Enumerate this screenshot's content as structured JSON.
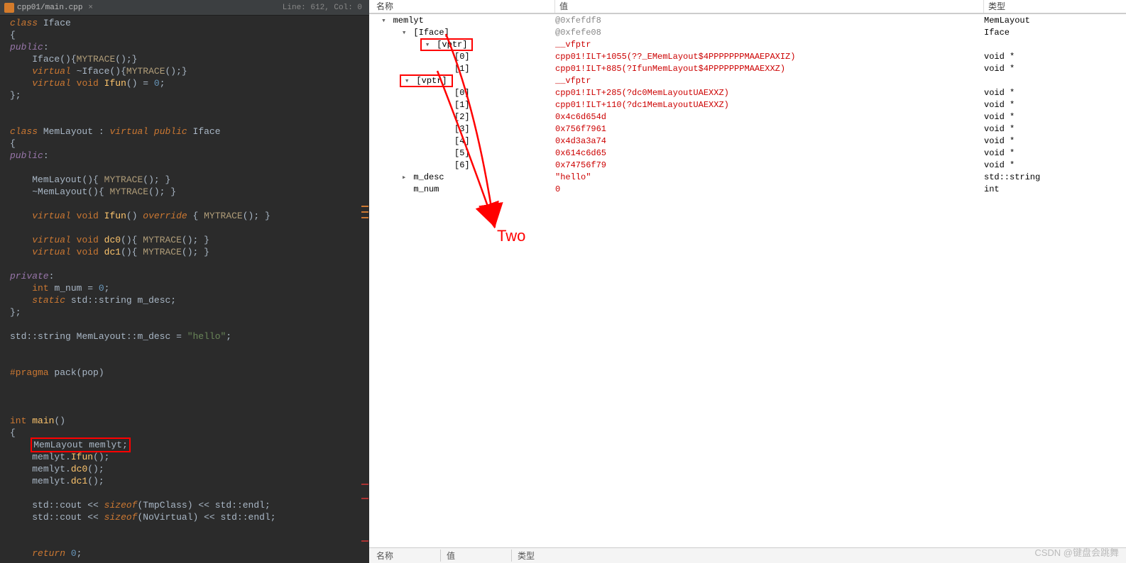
{
  "tab": {
    "filename": "cpp01/main.cpp",
    "close": "×"
  },
  "statusbar": {
    "linecol": "Line: 612, Col: 0"
  },
  "code_lines": [
    [
      [
        "key",
        "class"
      ],
      [
        "sp",
        " "
      ],
      [
        "type",
        "Iface"
      ]
    ],
    [
      [
        "op",
        "{"
      ]
    ],
    [
      [
        "pub",
        "public"
      ],
      [
        "op",
        ":"
      ]
    ],
    [
      [
        "sp",
        "    "
      ],
      [
        "type",
        "Iface"
      ],
      [
        "op",
        "()"
      ],
      [
        "op",
        "{"
      ],
      [
        "call",
        "MYTRACE"
      ],
      [
        "op",
        "();"
      ],
      [
        "op",
        "}"
      ]
    ],
    [
      [
        "sp",
        "    "
      ],
      [
        "key",
        "virtual"
      ],
      [
        "sp",
        " "
      ],
      [
        "op",
        "~"
      ],
      [
        "type",
        "Iface"
      ],
      [
        "op",
        "()"
      ],
      [
        "op",
        "{"
      ],
      [
        "call",
        "MYTRACE"
      ],
      [
        "op",
        "();"
      ],
      [
        "op",
        "}"
      ]
    ],
    [
      [
        "sp",
        "    "
      ],
      [
        "key",
        "virtual"
      ],
      [
        "sp",
        " "
      ],
      [
        "key2",
        "void"
      ],
      [
        "sp",
        " "
      ],
      [
        "fn",
        "Ifun"
      ],
      [
        "op",
        "() = "
      ],
      [
        "num",
        "0"
      ],
      [
        "op",
        ";"
      ]
    ],
    [
      [
        "op",
        "};"
      ]
    ],
    [
      [
        "sp",
        ""
      ]
    ],
    [
      [
        "sp",
        ""
      ]
    ],
    [
      [
        "key",
        "class"
      ],
      [
        "sp",
        " "
      ],
      [
        "type",
        "MemLayout"
      ],
      [
        "sp",
        " "
      ],
      [
        "op",
        ":"
      ],
      [
        "sp",
        " "
      ],
      [
        "key",
        "virtual"
      ],
      [
        "sp",
        " "
      ],
      [
        "key",
        "public"
      ],
      [
        "sp",
        " "
      ],
      [
        "type",
        "Iface"
      ]
    ],
    [
      [
        "op",
        "{"
      ]
    ],
    [
      [
        "pub",
        "public"
      ],
      [
        "op",
        ":"
      ]
    ],
    [
      [
        "sp",
        ""
      ]
    ],
    [
      [
        "sp",
        "    "
      ],
      [
        "type",
        "MemLayout"
      ],
      [
        "op",
        "(){ "
      ],
      [
        "call",
        "MYTRACE"
      ],
      [
        "op",
        "(); }"
      ]
    ],
    [
      [
        "sp",
        "    "
      ],
      [
        "op",
        "~"
      ],
      [
        "type",
        "MemLayout"
      ],
      [
        "op",
        "(){ "
      ],
      [
        "call",
        "MYTRACE"
      ],
      [
        "op",
        "(); }"
      ]
    ],
    [
      [
        "sp",
        ""
      ]
    ],
    [
      [
        "sp",
        "    "
      ],
      [
        "key",
        "virtual"
      ],
      [
        "sp",
        " "
      ],
      [
        "key2",
        "void"
      ],
      [
        "sp",
        " "
      ],
      [
        "fn",
        "Ifun"
      ],
      [
        "op",
        "() "
      ],
      [
        "key",
        "override"
      ],
      [
        "op",
        " { "
      ],
      [
        "call",
        "MYTRACE"
      ],
      [
        "op",
        "(); }"
      ]
    ],
    [
      [
        "sp",
        ""
      ]
    ],
    [
      [
        "sp",
        "    "
      ],
      [
        "key",
        "virtual"
      ],
      [
        "sp",
        " "
      ],
      [
        "key2",
        "void"
      ],
      [
        "sp",
        " "
      ],
      [
        "fn",
        "dc0"
      ],
      [
        "op",
        "(){ "
      ],
      [
        "call",
        "MYTRACE"
      ],
      [
        "op",
        "(); }"
      ]
    ],
    [
      [
        "sp",
        "    "
      ],
      [
        "key",
        "virtual"
      ],
      [
        "sp",
        " "
      ],
      [
        "key2",
        "void"
      ],
      [
        "sp",
        " "
      ],
      [
        "fn",
        "dc1"
      ],
      [
        "op",
        "(){ "
      ],
      [
        "call",
        "MYTRACE"
      ],
      [
        "op",
        "(); }"
      ]
    ],
    [
      [
        "sp",
        ""
      ]
    ],
    [
      [
        "pub",
        "private"
      ],
      [
        "op",
        ":"
      ]
    ],
    [
      [
        "sp",
        "    "
      ],
      [
        "key2",
        "int"
      ],
      [
        "sp",
        " "
      ],
      [
        "id",
        "m_num"
      ],
      [
        "op",
        " = "
      ],
      [
        "num",
        "0"
      ],
      [
        "op",
        ";"
      ]
    ],
    [
      [
        "sp",
        "    "
      ],
      [
        "key",
        "static"
      ],
      [
        "sp",
        " "
      ],
      [
        "id",
        "std"
      ],
      [
        "op",
        "::"
      ],
      [
        "id",
        "string"
      ],
      [
        "sp",
        " "
      ],
      [
        "id",
        "m_desc"
      ],
      [
        "op",
        ";"
      ]
    ],
    [
      [
        "op",
        "};"
      ]
    ],
    [
      [
        "sp",
        ""
      ]
    ],
    [
      [
        "id",
        "std"
      ],
      [
        "op",
        "::"
      ],
      [
        "id",
        "string"
      ],
      [
        "sp",
        " "
      ],
      [
        "id",
        "MemLayout"
      ],
      [
        "op",
        "::"
      ],
      [
        "id",
        "m_desc"
      ],
      [
        "op",
        " = "
      ],
      [
        "str",
        "\"hello\""
      ],
      [
        "op",
        ";"
      ]
    ],
    [
      [
        "sp",
        ""
      ]
    ],
    [
      [
        "sp",
        ""
      ]
    ],
    [
      [
        "pre",
        "#pragma"
      ],
      [
        "sp",
        " "
      ],
      [
        "id",
        "pack"
      ],
      [
        "op",
        "("
      ],
      [
        "id",
        "pop"
      ],
      [
        "op",
        ")"
      ]
    ],
    [
      [
        "sp",
        ""
      ]
    ],
    [
      [
        "sp",
        ""
      ]
    ],
    [
      [
        "sp",
        ""
      ]
    ],
    [
      [
        "key2",
        "int"
      ],
      [
        "sp",
        " "
      ],
      [
        "fn",
        "main"
      ],
      [
        "op",
        "()"
      ]
    ],
    [
      [
        "op",
        "{"
      ]
    ],
    [
      [
        "sp",
        "    "
      ],
      [
        "REDBOX_OPEN",
        ""
      ],
      [
        "type",
        "MemLayout"
      ],
      [
        "sp",
        " "
      ],
      [
        "id",
        "memlyt"
      ],
      [
        "op",
        ";"
      ],
      [
        "REDBOX_CLOSE",
        ""
      ]
    ],
    [
      [
        "sp",
        "    "
      ],
      [
        "id",
        "memlyt"
      ],
      [
        "op",
        "."
      ],
      [
        "fn",
        "Ifun"
      ],
      [
        "op",
        "();"
      ]
    ],
    [
      [
        "sp",
        "    "
      ],
      [
        "id",
        "memlyt"
      ],
      [
        "op",
        "."
      ],
      [
        "fn",
        "dc0"
      ],
      [
        "op",
        "();"
      ]
    ],
    [
      [
        "sp",
        "    "
      ],
      [
        "id",
        "memlyt"
      ],
      [
        "op",
        "."
      ],
      [
        "fn",
        "dc1"
      ],
      [
        "op",
        "();"
      ]
    ],
    [
      [
        "sp",
        ""
      ]
    ],
    [
      [
        "sp",
        "    "
      ],
      [
        "id",
        "std"
      ],
      [
        "op",
        "::"
      ],
      [
        "id",
        "cout"
      ],
      [
        "op",
        " << "
      ],
      [
        "key",
        "sizeof"
      ],
      [
        "op",
        "("
      ],
      [
        "type",
        "TmpClass"
      ],
      [
        "op",
        ") << "
      ],
      [
        "id",
        "std"
      ],
      [
        "op",
        "::"
      ],
      [
        "id",
        "endl"
      ],
      [
        "op",
        ";"
      ]
    ],
    [
      [
        "sp",
        "    "
      ],
      [
        "id",
        "std"
      ],
      [
        "op",
        "::"
      ],
      [
        "id",
        "cout"
      ],
      [
        "op",
        " << "
      ],
      [
        "key",
        "sizeof"
      ],
      [
        "op",
        "("
      ],
      [
        "type",
        "NoVirtual"
      ],
      [
        "op",
        ") << "
      ],
      [
        "id",
        "std"
      ],
      [
        "op",
        "::"
      ],
      [
        "id",
        "endl"
      ],
      [
        "op",
        ";"
      ]
    ],
    [
      [
        "sp",
        ""
      ]
    ],
    [
      [
        "sp",
        ""
      ]
    ],
    [
      [
        "sp",
        "    "
      ],
      [
        "key",
        "return"
      ],
      [
        "sp",
        " "
      ],
      [
        "num",
        "0"
      ],
      [
        "op",
        ";"
      ]
    ]
  ],
  "watch": {
    "headers": {
      "name": "名称",
      "value": "值",
      "type": "类型"
    },
    "search": {
      "name": "名称",
      "value": "值",
      "type": "类型"
    },
    "annotation": "Two",
    "rows": [
      {
        "indent": 0,
        "chev": "v",
        "box": false,
        "name": "memlyt",
        "value": "@0xfefdf8",
        "valgrey": true,
        "type": "MemLayout"
      },
      {
        "indent": 1,
        "chev": "v",
        "box": false,
        "name": "[Iface]",
        "value": "@0xfefe08",
        "valgrey": true,
        "type": "Iface"
      },
      {
        "indent": 2,
        "chev": "v",
        "box": true,
        "name": "[vptr]",
        "value": "__vfptr",
        "valgrey": false,
        "type": ""
      },
      {
        "indent": 3,
        "chev": "",
        "box": false,
        "name": "[0]",
        "value": "cpp01!ILT+1055(??_EMemLayout$4PPPPPPPMAAEPAXIZ)",
        "valgrey": false,
        "type": "void *"
      },
      {
        "indent": 3,
        "chev": "",
        "box": false,
        "name": "[1]",
        "value": "cpp01!ILT+885(?IfunMemLayout$4PPPPPPPMAAEXXZ)",
        "valgrey": false,
        "type": "void *"
      },
      {
        "indent": 1,
        "chev": "v",
        "box": true,
        "name": "[vptr]",
        "value": "__vfptr",
        "valgrey": false,
        "type": ""
      },
      {
        "indent": 3,
        "chev": "",
        "box": false,
        "name": "[0]",
        "value": "cpp01!ILT+285(?dc0MemLayoutUAEXXZ)",
        "valgrey": false,
        "type": "void *"
      },
      {
        "indent": 3,
        "chev": "",
        "box": false,
        "name": "[1]",
        "value": "cpp01!ILT+110(?dc1MemLayoutUAEXXZ)",
        "valgrey": false,
        "type": "void *"
      },
      {
        "indent": 3,
        "chev": "",
        "box": false,
        "name": "[2]",
        "value": "0x4c6d654d",
        "valgrey": false,
        "type": "void *"
      },
      {
        "indent": 3,
        "chev": "",
        "box": false,
        "name": "[3]",
        "value": "0x756f7961",
        "valgrey": false,
        "type": "void *"
      },
      {
        "indent": 3,
        "chev": "",
        "box": false,
        "name": "[4]",
        "value": "0x4d3a3a74",
        "valgrey": false,
        "type": "void *"
      },
      {
        "indent": 3,
        "chev": "",
        "box": false,
        "name": "[5]",
        "value": "0x614c6d65",
        "valgrey": false,
        "type": "void *"
      },
      {
        "indent": 3,
        "chev": "",
        "box": false,
        "name": "[6]",
        "value": "0x74756f79",
        "valgrey": false,
        "type": "void *"
      },
      {
        "indent": 1,
        "chev": ">",
        "box": false,
        "name": "m_desc",
        "value": "\"hello\"",
        "valgrey": false,
        "type": "std::string"
      },
      {
        "indent": 1,
        "chev": "",
        "box": false,
        "name": "m_num",
        "value": "0",
        "valgrey": false,
        "type": "int"
      }
    ]
  },
  "watermark": "CSDN @键盘会跳舞"
}
